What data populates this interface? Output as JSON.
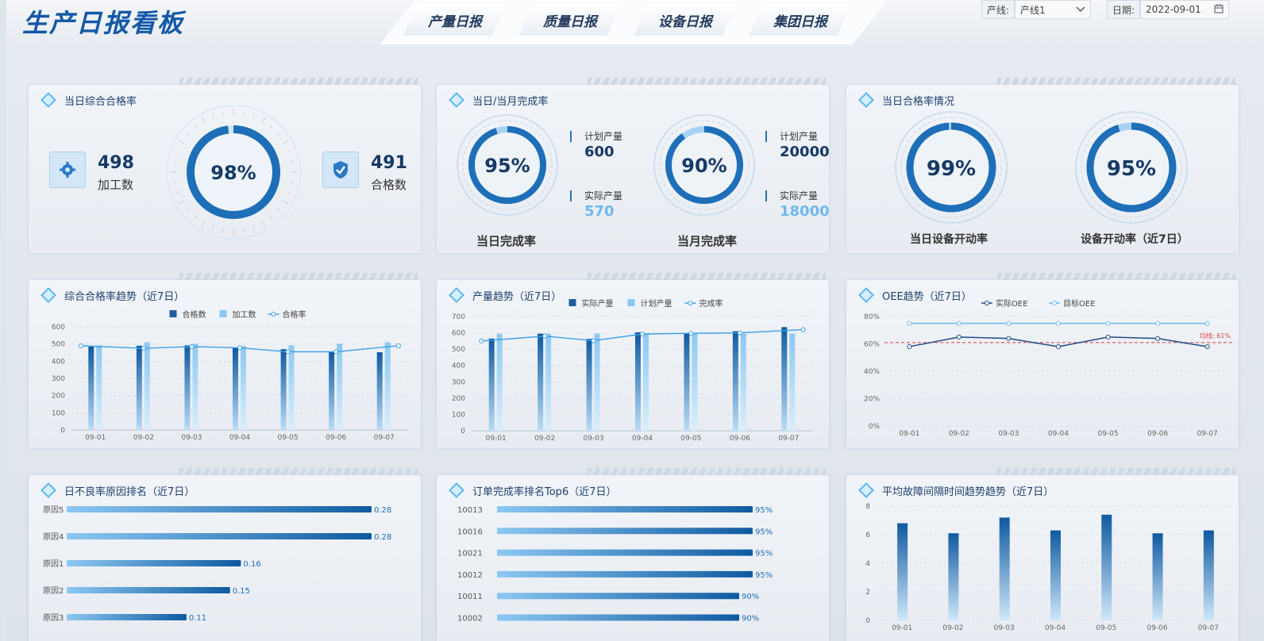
{
  "header": {
    "title": "生产日报看板",
    "tabs": [
      "产量日报",
      "质量日报",
      "设备日报",
      "集团日报"
    ],
    "filter_line": {
      "label": "产线:",
      "value": "产线1"
    },
    "filter_date": {
      "label": "日期:",
      "value": "2022-09-01"
    }
  },
  "icons": {
    "calendar": "calendar-icon",
    "chevron": "chevron-down-icon",
    "gear": "gear-icon",
    "shield": "shield-check-icon"
  },
  "colors": {
    "dark_blue": "#0f5aa0",
    "light_blue": "#6fb8ee",
    "accent_line": "#3aa0ea",
    "target_red": "#e04040"
  },
  "p1": {
    "title": "当日综合合格率",
    "process_value": "498",
    "process_label": "加工数",
    "pass_value": "491",
    "pass_label": "合格数",
    "rate": "98%",
    "rate_value": 98
  },
  "p2": {
    "title": "当日/当月完成率",
    "day": {
      "rate": "95%",
      "rate_value": 95,
      "plan_label": "计划产量",
      "plan": "600",
      "actual_label": "实际产量",
      "actual": "570",
      "caption": "当日完成率"
    },
    "month": {
      "rate": "90%",
      "rate_value": 90,
      "plan_label": "计划产量",
      "plan": "20000",
      "actual_label": "实际产量",
      "actual": "18000",
      "caption": "当月完成率"
    }
  },
  "p3": {
    "title": "当日合格率情况",
    "g1": {
      "rate": "99%",
      "rate_value": 99,
      "caption": "当日设备开动率"
    },
    "g2": {
      "rate": "95%",
      "rate_value": 95,
      "caption": "设备开动率（近7日）"
    }
  },
  "p4": {
    "title": "综合合格率趋势（近7日）"
  },
  "p5": {
    "title": "产量趋势（近7日）"
  },
  "p6": {
    "title": "OEE趋势（近7日）"
  },
  "p7": {
    "title": "日不良率原因排名（近7日）"
  },
  "p8": {
    "title": "订单完成率排名Top6（近7日）"
  },
  "p9": {
    "title": "平均故障间隔时间趋势趋势（近7日）"
  },
  "chart_data": [
    {
      "id": "quality",
      "type": "bar",
      "categories": [
        "09-01",
        "09-02",
        "09-03",
        "09-04",
        "09-05",
        "09-06",
        "09-07"
      ],
      "series": [
        {
          "name": "合格数",
          "values": [
            485,
            490,
            492,
            478,
            470,
            455,
            452
          ]
        },
        {
          "name": "加工数",
          "values": [
            492,
            510,
            502,
            488,
            492,
            502,
            510
          ]
        },
        {
          "name": "合格率",
          "type": "line",
          "values": [
            490,
            475,
            485,
            478,
            455,
            455,
            490
          ]
        }
      ],
      "ylim": [
        0,
        600
      ],
      "yticks": [
        0,
        100,
        200,
        300,
        400,
        500,
        600
      ]
    },
    {
      "id": "output",
      "type": "bar",
      "categories": [
        "09-01",
        "09-02",
        "09-03",
        "09-04",
        "09-05",
        "09-06",
        "09-07"
      ],
      "series": [
        {
          "name": "实际产量",
          "values": [
            565,
            595,
            563,
            603,
            598,
            610,
            635
          ]
        },
        {
          "name": "计划产量",
          "values": [
            595,
            595,
            595,
            595,
            595,
            595,
            595
          ]
        },
        {
          "name": "完成率",
          "type": "line",
          "values": [
            550,
            580,
            552,
            593,
            597,
            600,
            620
          ]
        }
      ],
      "ylim": [
        0,
        700
      ],
      "yticks": [
        0,
        100,
        200,
        300,
        400,
        500,
        600,
        700
      ]
    },
    {
      "id": "oee",
      "type": "line",
      "categories": [
        "09-01",
        "09-02",
        "09-03",
        "09-04",
        "09-05",
        "09-06",
        "09-07"
      ],
      "series": [
        {
          "name": "实际OEE",
          "values": [
            58,
            65,
            64,
            58,
            65,
            64,
            58
          ]
        },
        {
          "name": "目标OEE",
          "values": [
            75,
            75,
            75,
            75,
            75,
            75,
            75
          ]
        }
      ],
      "target": {
        "label": "均线: 61%",
        "value": 61
      },
      "ylim": [
        0,
        80
      ],
      "yticks": [
        "0%",
        "20%",
        "40%",
        "60%",
        "80%"
      ]
    },
    {
      "id": "defect",
      "type": "bar",
      "orientation": "horizontal",
      "categories": [
        "原因5",
        "原因4",
        "原因1",
        "原因2",
        "原因3"
      ],
      "values": [
        0.28,
        0.28,
        0.16,
        0.15,
        0.11
      ],
      "xlim": [
        0,
        0.28
      ]
    },
    {
      "id": "order",
      "type": "bar",
      "orientation": "horizontal",
      "categories": [
        "10013",
        "10016",
        "10021",
        "10012",
        "10011",
        "10002"
      ],
      "values": [
        95,
        95,
        95,
        95,
        90,
        90
      ],
      "labels": [
        "95%",
        "95%",
        "95%",
        "95%",
        "90%",
        "90%"
      ],
      "xlim": [
        0,
        95
      ]
    },
    {
      "id": "mtbf",
      "type": "bar",
      "categories": [
        "09-01",
        "09-02",
        "09-03",
        "09-04",
        "09-05",
        "09-06",
        "09-07"
      ],
      "values": [
        6.8,
        6.1,
        7.2,
        6.3,
        7.4,
        6.1,
        6.3
      ],
      "ylim": [
        0,
        8
      ],
      "yticks": [
        0,
        2,
        4,
        6,
        8
      ]
    }
  ]
}
